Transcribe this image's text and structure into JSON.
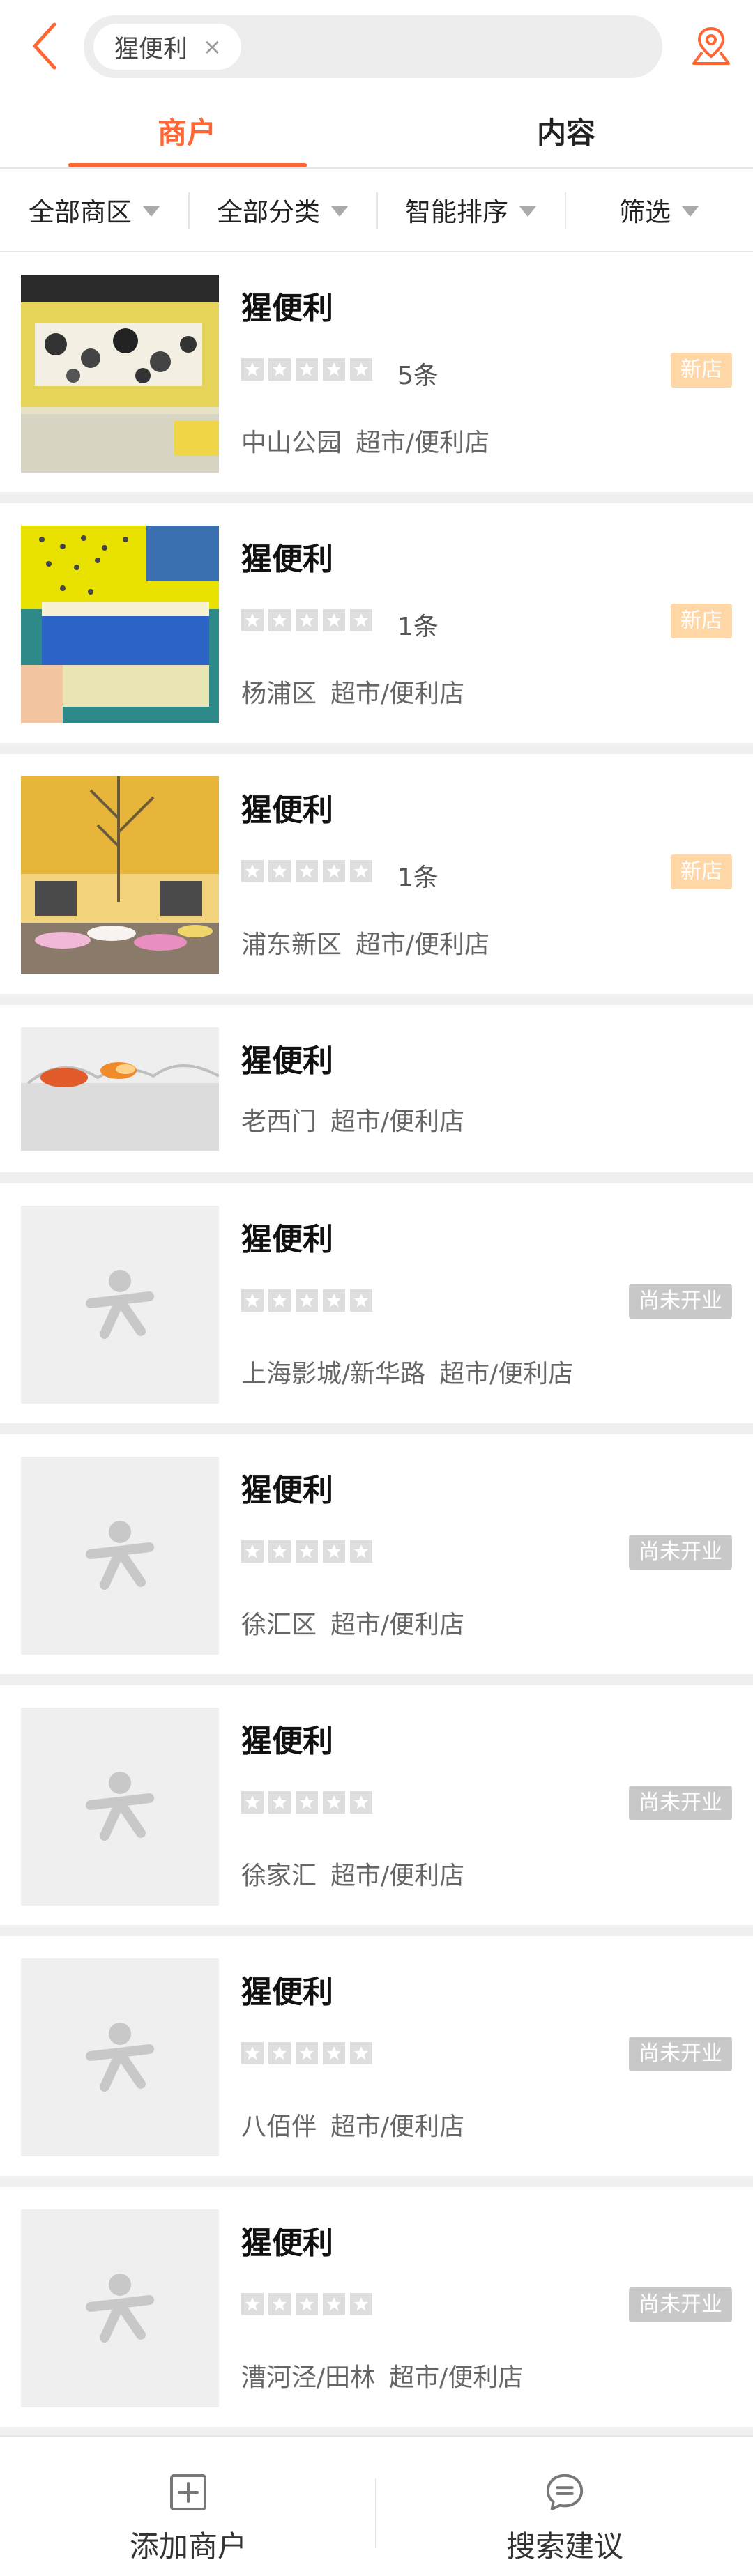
{
  "search": {
    "chip_text": "猩便利",
    "chip_close": "×"
  },
  "tabs": [
    {
      "label": "商户",
      "active": true
    },
    {
      "label": "内容",
      "active": false
    }
  ],
  "filters": [
    {
      "label": "全部商区"
    },
    {
      "label": "全部分类"
    },
    {
      "label": "智能排序"
    },
    {
      "label": "筛选"
    }
  ],
  "colors": {
    "accent": "#ff6633",
    "badge_new": "#ffd6a6",
    "badge_closed": "#c8c8c8"
  },
  "shops": [
    {
      "name": "猩便利",
      "reviews": "5条",
      "badge": "新店",
      "area": "中山公园",
      "category": "超市/便利店",
      "image": "photo-interior"
    },
    {
      "name": "猩便利",
      "reviews": "1条",
      "badge": "新店",
      "area": "杨浦区",
      "category": "超市/便利店",
      "image": "photo-cup-noodle"
    },
    {
      "name": "猩便利",
      "reviews": "1条",
      "badge": "新店",
      "area": "浦东新区",
      "category": "超市/便利店",
      "image": "photo-storefront"
    },
    {
      "name": "猩便利",
      "reviews": "",
      "badge": "",
      "area": "老西门",
      "category": "超市/便利店",
      "image": "photo-snack"
    },
    {
      "name": "猩便利",
      "reviews": "",
      "badge": "尚未开业",
      "area": "上海影城/新华路",
      "category": "超市/便利店",
      "image": "placeholder"
    },
    {
      "name": "猩便利",
      "reviews": "",
      "badge": "尚未开业",
      "area": "徐汇区",
      "category": "超市/便利店",
      "image": "placeholder"
    },
    {
      "name": "猩便利",
      "reviews": "",
      "badge": "尚未开业",
      "area": "徐家汇",
      "category": "超市/便利店",
      "image": "placeholder"
    },
    {
      "name": "猩便利",
      "reviews": "",
      "badge": "尚未开业",
      "area": "八佰伴",
      "category": "超市/便利店",
      "image": "placeholder"
    },
    {
      "name": "猩便利",
      "reviews": "",
      "badge": "尚未开业",
      "area": "漕河泾/田林",
      "category": "超市/便利店",
      "image": "placeholder"
    }
  ],
  "bottom_bar": {
    "add_shop": {
      "label": "添加商户",
      "icon": "plus-square-icon"
    },
    "suggest": {
      "label": "搜索建议",
      "icon": "chat-bubble-icon"
    }
  }
}
